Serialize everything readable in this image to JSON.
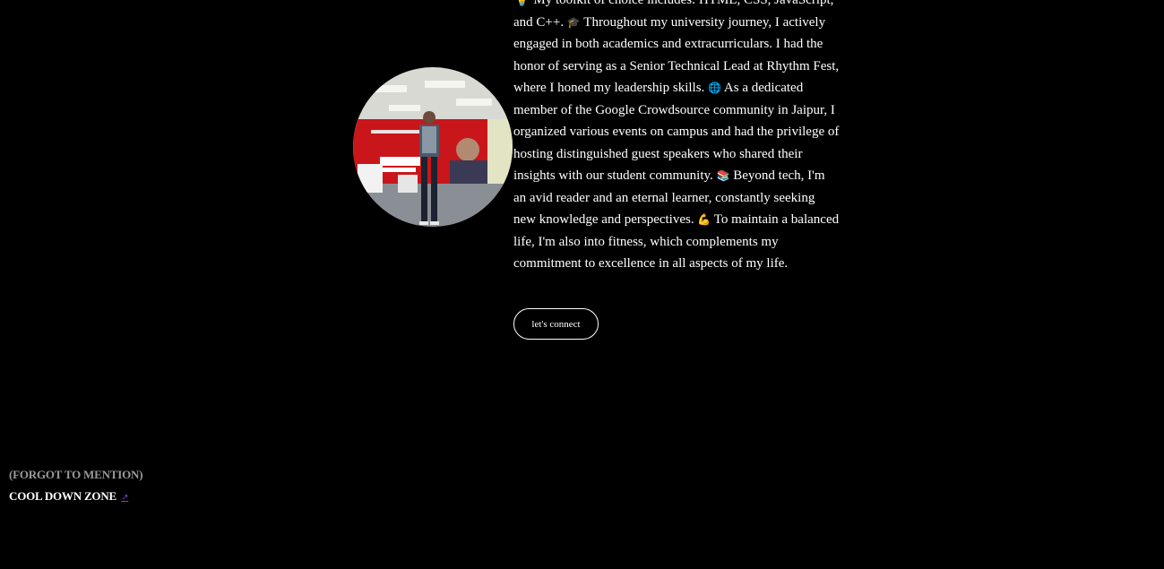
{
  "about": {
    "bio_lines": [
      "💡 My toolkit of choice includes:",
      "HTML, CSS, JavaScript, and C++.",
      "Throughout my university journey, I actively engaged in both academics and extracurriculars. I had the honor of serving as a Senior Technical Lead at Rhythm Fest, where I honed my leadership skills.",
      "As a dedicated member of the Google Crowdsource community in Jaipur, I organized various events on campus and had the privilege of hosting distinguished guest speakers who shared their insights with our student community.",
      "Beyond tech, I'm an avid reader and an eternal learner, constantly seeking new knowledge and perspectives.",
      "To maintain a balanced life, I'm also into fitness, which complements my commitment to excellence in all aspects of my life."
    ],
    "icons": [
      "graduation-cap-icon",
      "globe-icon",
      "books-icon",
      "flexed-biceps-icon"
    ],
    "connect_button": "let's connect"
  },
  "footer": {
    "forgot_label": "(FORGOT TO MENTION)",
    "cooldown_label": "COOL DOWN ZONE",
    "cooldown_arrow": "↗"
  },
  "colors": {
    "background": "#000000",
    "text": "#ffffff",
    "muted": "#9a9a9a",
    "link_arrow": "#7a3fd1"
  }
}
